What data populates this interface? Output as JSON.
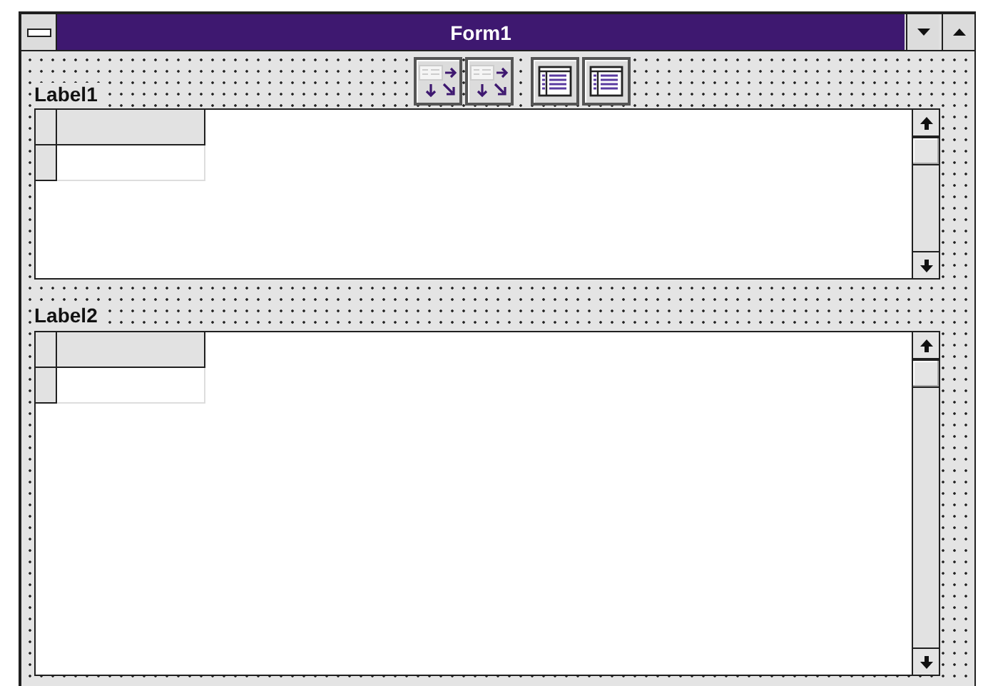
{
  "window": {
    "title": "Form1"
  },
  "sections": [
    {
      "label": "Label1",
      "kind": "short"
    },
    {
      "label": "Label2",
      "kind": "tall"
    }
  ],
  "toolbar": [
    {
      "kind": "arrange"
    },
    {
      "kind": "arrange"
    },
    {
      "kind": "list"
    },
    {
      "kind": "list"
    }
  ]
}
